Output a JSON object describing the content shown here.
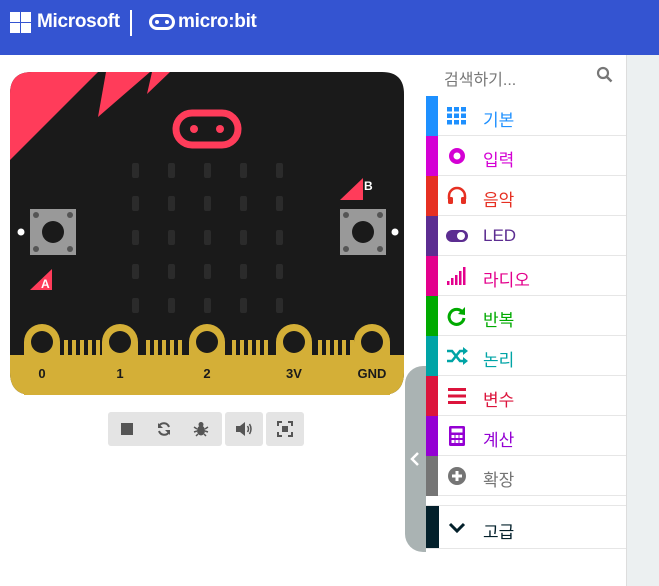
{
  "header": {
    "brand": "Microsoft",
    "product": "micro:bit",
    "background": "#3454d1"
  },
  "simulator": {
    "pins": [
      "0",
      "1",
      "2",
      "3V",
      "GND"
    ],
    "button_a": "A",
    "button_b": "B",
    "toolbar_icons": [
      "stop-icon",
      "restart-icon",
      "debug-icon",
      "sound-icon",
      "fullscreen-icon"
    ]
  },
  "toolbox": {
    "search_placeholder": "검색하기...",
    "categories": [
      {
        "label": "기본",
        "color": "#1e90ff",
        "icon": "grid-icon"
      },
      {
        "label": "입력",
        "color": "#d400d4",
        "icon": "input-circle-icon"
      },
      {
        "label": "음악",
        "color": "#e63022",
        "icon": "headphones-icon"
      },
      {
        "label": "LED",
        "color": "#5c2d91",
        "icon": "toggle-icon"
      },
      {
        "label": "라디오",
        "color": "#e3008c",
        "icon": "signal-bars-icon"
      },
      {
        "label": "반복",
        "color": "#00aa00",
        "icon": "loop-arrow-icon"
      },
      {
        "label": "논리",
        "color": "#00a4a6",
        "icon": "shuffle-icon"
      },
      {
        "label": "변수",
        "color": "#dc143c",
        "icon": "list-lines-icon"
      },
      {
        "label": "계산",
        "color": "#9400d3",
        "icon": "calculator-icon"
      },
      {
        "label": "확장",
        "color": "#757575",
        "icon": "plus-circle-icon"
      }
    ],
    "advanced": {
      "label": "고급",
      "color": "#03202b",
      "icon": "chevron-down-icon"
    }
  }
}
